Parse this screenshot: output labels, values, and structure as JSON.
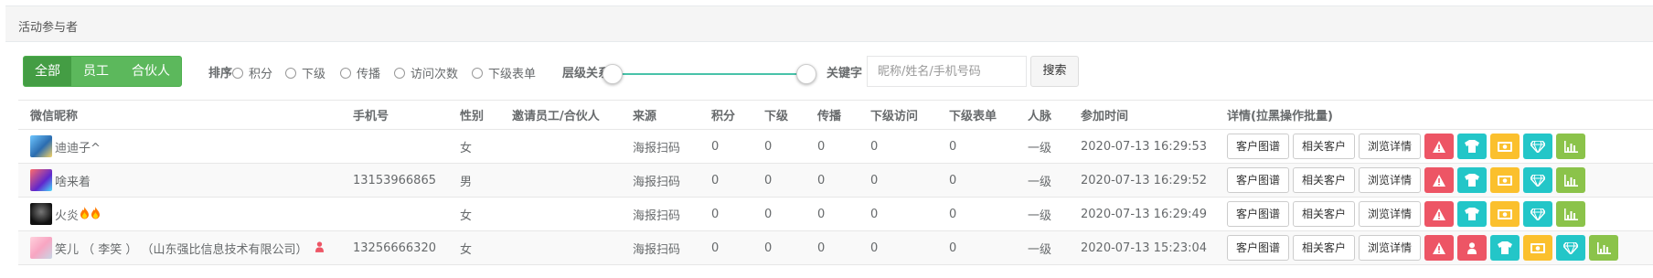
{
  "panel": {
    "title": "活动参与者"
  },
  "filters": {
    "segments": [
      "全部",
      "员工",
      "合伙人"
    ],
    "sort_label": "排序",
    "sort_options": [
      "积分",
      "下级",
      "传播",
      "访问次数",
      "下级表单"
    ],
    "level_label": "层级关系",
    "keyword_label": "关键字",
    "keyword_placeholder": "昵称/姓名/手机号码",
    "search_label": "搜索"
  },
  "table": {
    "headers": [
      "微信昵称",
      "手机号",
      "性别",
      "邀请员工/合伙人",
      "来源",
      "积分",
      "下级",
      "传播",
      "下级访问",
      "下级表单",
      "人脉",
      "参加时间",
      "详情(拉黑操作批量)"
    ],
    "action_labels": {
      "portrait": "客户图谱",
      "related": "相关客户",
      "browse": "浏览详情"
    },
    "rows": [
      {
        "nickname": "迪迪子^",
        "phone": "",
        "gender": "女",
        "inviter": "",
        "source": "海报扫码",
        "points": "0",
        "sub": "0",
        "spread": "0",
        "sub_visits": "0",
        "sub_forms": "0",
        "network": "一级",
        "joined": "2020-07-13 16:29:53",
        "has_person_icon": false
      },
      {
        "nickname": "啥来着",
        "phone": "13153966865",
        "gender": "男",
        "inviter": "",
        "source": "海报扫码",
        "points": "0",
        "sub": "0",
        "spread": "0",
        "sub_visits": "0",
        "sub_forms": "0",
        "network": "一级",
        "joined": "2020-07-13 16:29:52",
        "has_person_icon": false
      },
      {
        "nickname": "火炎",
        "phone": "",
        "gender": "女",
        "inviter": "",
        "source": "海报扫码",
        "points": "0",
        "sub": "0",
        "spread": "0",
        "sub_visits": "0",
        "sub_forms": "0",
        "network": "一级",
        "joined": "2020-07-13 16:29:49",
        "has_person_icon": false
      },
      {
        "nickname": "笑儿 （ 李笑 ） （山东强比信息技术有限公司）",
        "phone": "13256666320",
        "gender": "女",
        "inviter": "",
        "source": "海报扫码",
        "points": "0",
        "sub": "0",
        "spread": "0",
        "sub_visits": "0",
        "sub_forms": "0",
        "network": "一级",
        "joined": "2020-07-13 15:23:04",
        "has_person_icon": true
      }
    ]
  },
  "colors": {
    "green": "#5cb85c",
    "red": "#ed5565",
    "teal": "#23c6c8",
    "yellow": "#fbc02d",
    "lime": "#8bc34a"
  }
}
